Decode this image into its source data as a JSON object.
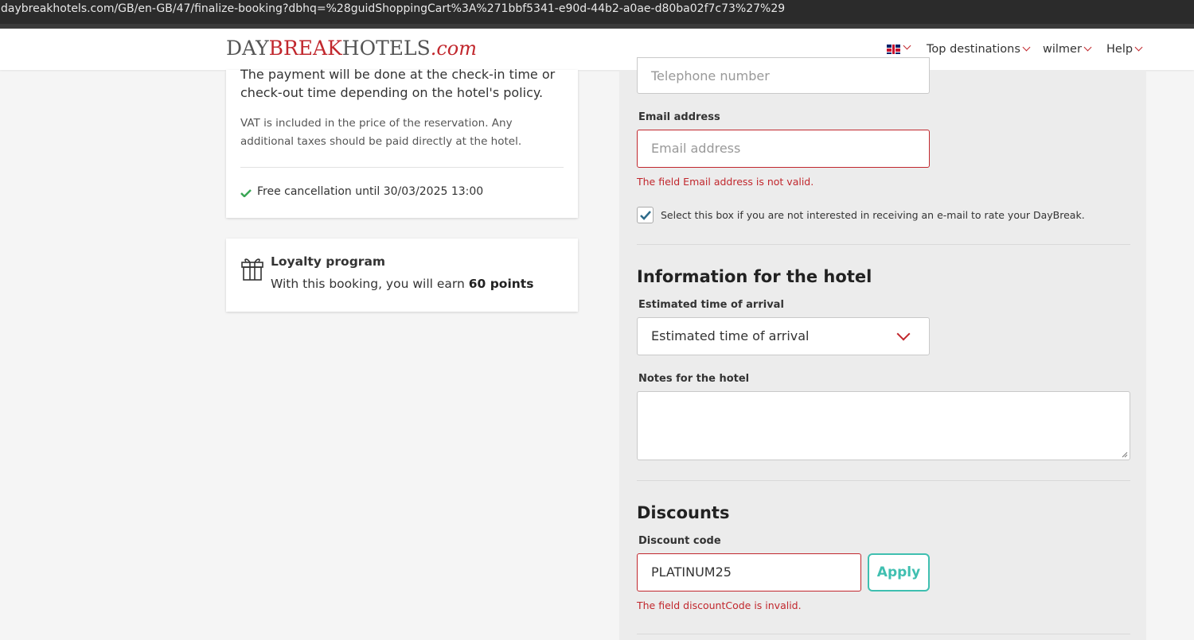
{
  "browser": {
    "url": "daybreakhotels.com/GB/en-GB/47/finalize-booking?dbhq=%28guidShoppingCart%3A%271bbf5341-e90d-44b2-a0ae-d80ba02f7c73%27%29"
  },
  "header": {
    "logo": {
      "part1": "DAY",
      "part2": "BREAK",
      "part3": "HOTELS",
      "part4": ".com"
    },
    "nav": {
      "language_icon": "uk-flag-icon",
      "top_destinations": "Top destinations",
      "user": "wilmer",
      "help": "Help"
    }
  },
  "summary": {
    "payment_text": "The payment will be done at the check-in time or check-out time depending on the hotel's policy.",
    "vat_text": "VAT is included in the price of the reservation. Any additional taxes should be paid directly at the hotel.",
    "free_cancellation": "Free cancellation until 30/03/2025 13:00"
  },
  "loyalty": {
    "title": "Loyalty program",
    "text_prefix": "With this booking, you will earn ",
    "points": "60 points"
  },
  "form": {
    "telephone_placeholder": "Telephone number",
    "email_label": "Email address",
    "email_placeholder": "Email address",
    "email_error": "The field Email address is not valid.",
    "rate_checkbox_label": "Select this box if you are not interested in receiving an e-mail to rate your DayBreak.",
    "rate_checkbox_checked": true,
    "hotel_section_title": "Information for the hotel",
    "arrival_label": "Estimated time of arrival",
    "arrival_value": "Estimated time of arrival",
    "notes_label": "Notes for the hotel",
    "discounts_title": "Discounts",
    "discount_label": "Discount code",
    "discount_value": "PLATINUM25",
    "apply_label": "Apply",
    "discount_error": "The field discountCode is invalid."
  },
  "colors": {
    "brand_red": "#c1272d",
    "accent_teal": "#3fbfb0",
    "check_green": "#3aa655"
  }
}
